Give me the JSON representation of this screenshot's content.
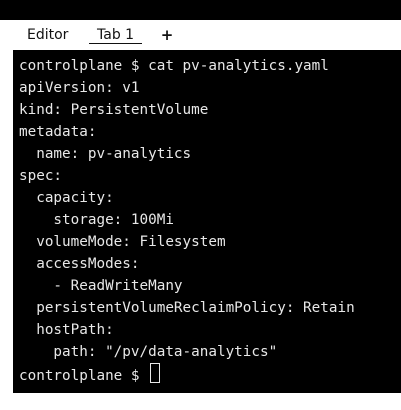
{
  "tabs": [
    {
      "label": "Editor"
    },
    {
      "label": "Tab 1"
    }
  ],
  "tab_add_label": "+",
  "terminal": {
    "lines": [
      "controlplane $ cat pv-analytics.yaml",
      "apiVersion: v1",
      "kind: PersistentVolume",
      "metadata:",
      "  name: pv-analytics",
      "spec:",
      "  capacity:",
      "    storage: 100Mi",
      "  volumeMode: Filesystem",
      "  accessModes:",
      "    - ReadWriteMany",
      "  persistentVolumeReclaimPolicy: Retain",
      "  hostPath:",
      "    path: \"/pv/data-analytics\""
    ],
    "prompt": "controlplane $"
  }
}
